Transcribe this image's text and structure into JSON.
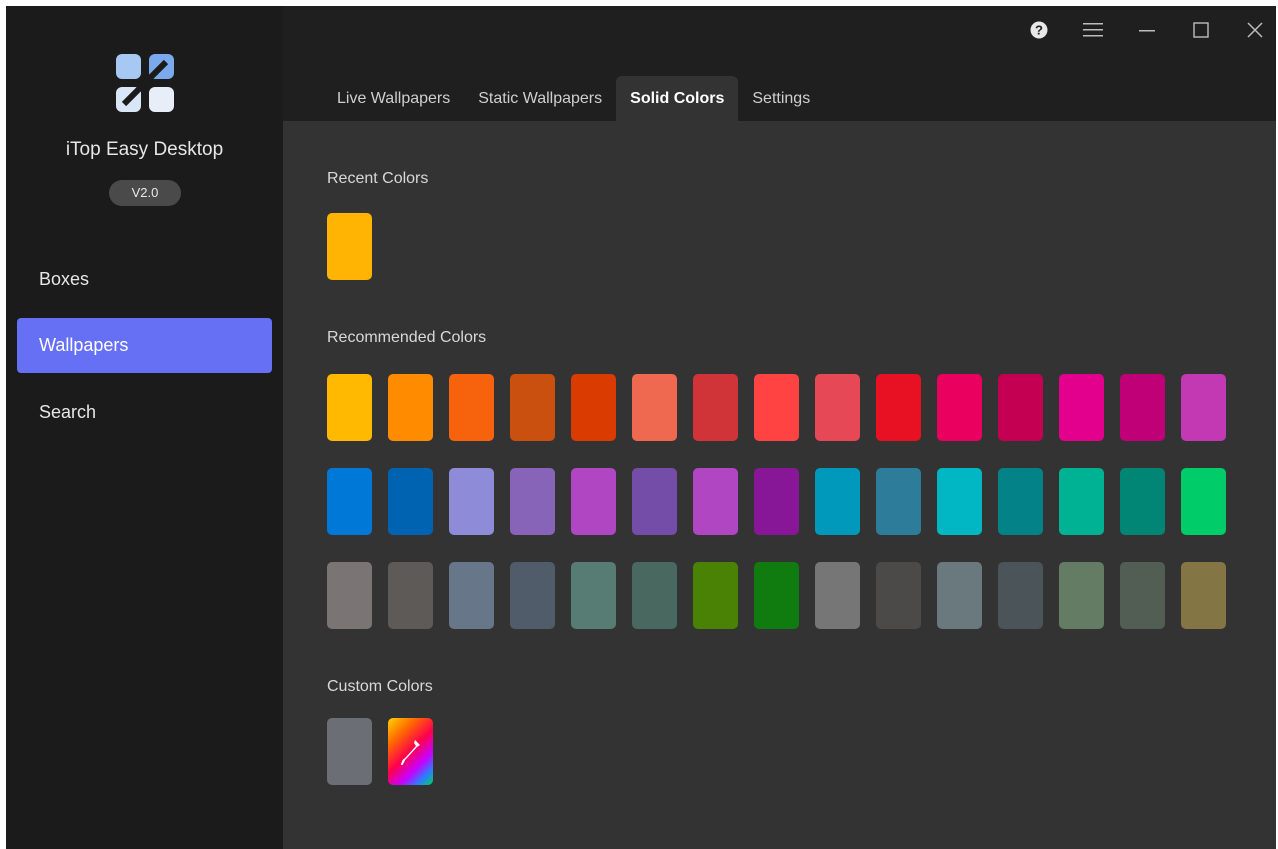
{
  "sidebar": {
    "app_name": "iTop Easy Desktop",
    "version": "V2.0",
    "items": [
      {
        "label": "Boxes",
        "active": false
      },
      {
        "label": "Wallpapers",
        "active": true
      },
      {
        "label": "Search",
        "active": false
      }
    ]
  },
  "tabs": [
    {
      "label": "Live Wallpapers",
      "active": false
    },
    {
      "label": "Static Wallpapers",
      "active": false
    },
    {
      "label": "Solid Colors",
      "active": true
    },
    {
      "label": "Settings",
      "active": false
    }
  ],
  "window_controls": [
    "help-icon",
    "menu-icon",
    "minimize-icon",
    "maximize-icon",
    "close-icon"
  ],
  "sections": {
    "recent": {
      "title": "Recent Colors",
      "colors": [
        "#ffb302"
      ]
    },
    "recommended": {
      "title": "Recommended Colors",
      "rows": [
        [
          "#ffb900",
          "#ff8c00",
          "#f7630c",
          "#ca5010",
          "#da3b01",
          "#ef6950",
          "#d13438",
          "#ff4343",
          "#e74856",
          "#e81123",
          "#ea005e",
          "#c30052",
          "#e3008c",
          "#bf0077",
          "#c239b3"
        ],
        [
          "#0078d7",
          "#0063b1",
          "#8e8cd8",
          "#8764b8",
          "#b146c2",
          "#744da9",
          "#b146c2",
          "#881798",
          "#0099bc",
          "#2d7d9a",
          "#00b7c3",
          "#038387",
          "#00b294",
          "#018574",
          "#00cc6a"
        ],
        [
          "#7a7574",
          "#5d5a58",
          "#68768a",
          "#515c6b",
          "#567c73",
          "#486860",
          "#498205",
          "#107c10",
          "#767676",
          "#4c4a48",
          "#69797e",
          "#4a5459",
          "#647c64",
          "#525e54",
          "#847545"
        ]
      ]
    },
    "custom": {
      "title": "Custom Colors",
      "colors": [
        "#6b6e74"
      ],
      "picker_icon": "eyedropper-icon"
    }
  },
  "accent_color": "#6670f5"
}
